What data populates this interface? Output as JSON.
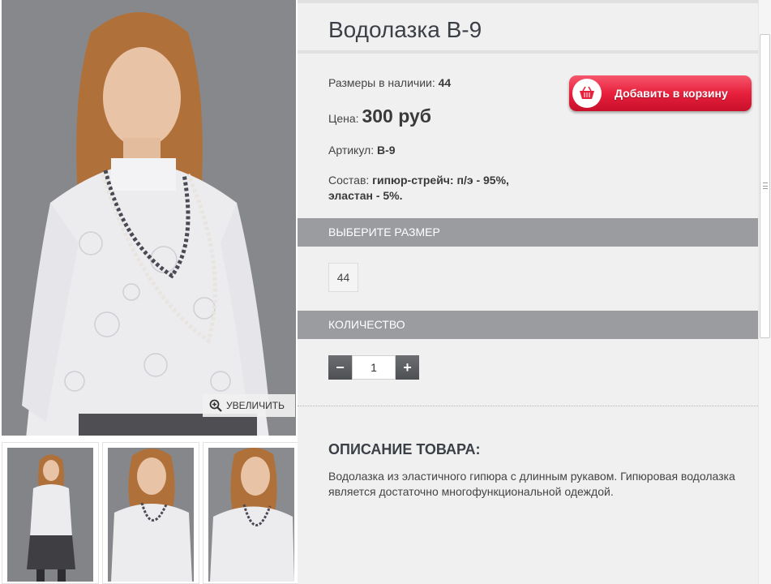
{
  "product": {
    "title": "Водолазка В-9",
    "sizes_label": "Размеры в наличии:",
    "sizes_value": "44",
    "price_label": "Цена:",
    "price_value": "300 руб",
    "sku_label": "Артикул:",
    "sku_value": "В-9",
    "composition_label": "Состав:",
    "composition_value_line1": "гипюр-стрейч: п/э - 95%,",
    "composition_value_line2": "эластан - 5%."
  },
  "cart_button": {
    "label": "Добавить в корзину",
    "icon": "basket-icon"
  },
  "zoom_button": {
    "label": "УВЕЛИЧИТЬ",
    "icon": "zoom-in-icon"
  },
  "size_section": {
    "title": "ВЫБЕРИТЕ РАЗМЕР",
    "options": [
      "44"
    ]
  },
  "quantity_section": {
    "title": "КОЛИЧЕСТВО",
    "value": "1",
    "minus": "−",
    "plus": "+"
  },
  "description": {
    "title": "ОПИСАНИЕ ТОВАРА:",
    "text": "Водолазка из эластичного гипюра с длинным рукавом. Гипюровая водолазка является достаточно многофункциональной одеждой."
  },
  "colors": {
    "accent_red": "#e8203c",
    "section_bar": "#9a9ca0",
    "panel_bg": "#f0f0f0"
  }
}
